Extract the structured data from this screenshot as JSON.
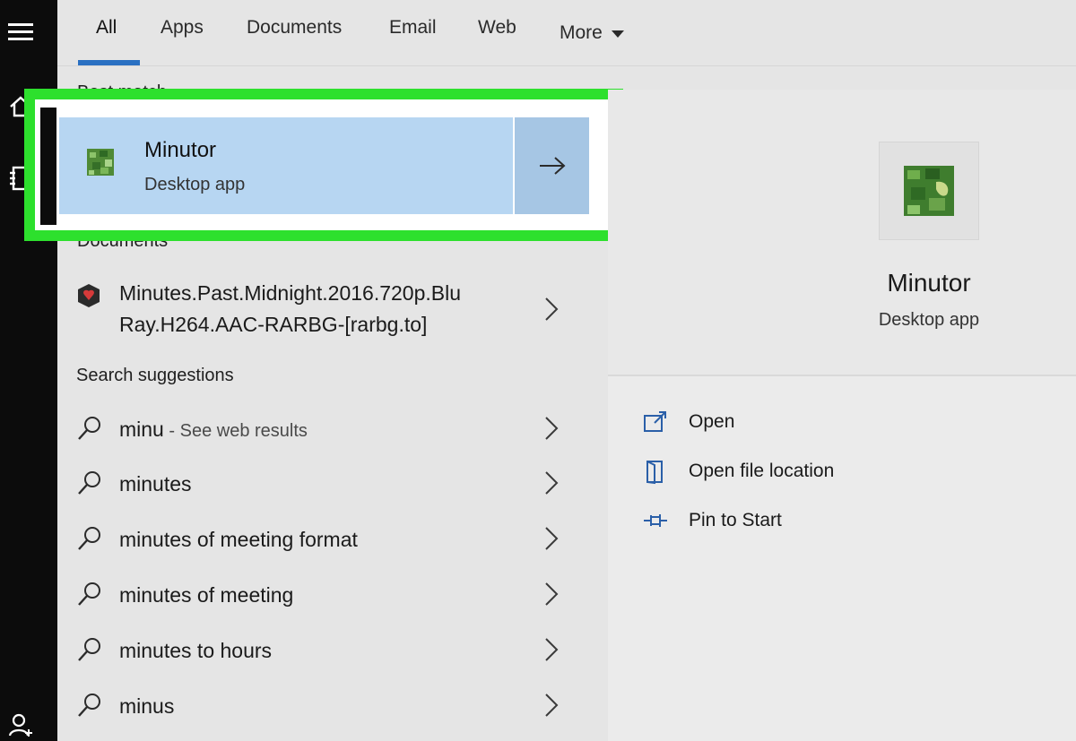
{
  "tabs": [
    {
      "label": "All"
    },
    {
      "label": "Apps"
    },
    {
      "label": "Documents"
    },
    {
      "label": "Email"
    },
    {
      "label": "Web"
    },
    {
      "label": "More"
    }
  ],
  "best_match": {
    "heading": "Best match",
    "title": "Minutor",
    "subtitle": "Desktop app"
  },
  "documents": {
    "heading": "Documents",
    "item": {
      "line1": "Minutes.Past.Midnight.2016.720p.Blu",
      "line2": "Ray.H264.AAC-RARBG-[rarbg.to]"
    }
  },
  "suggestions": {
    "heading": "Search suggestions",
    "items": [
      {
        "text": "minu",
        "hint": " - See web results"
      },
      {
        "text": "minutes"
      },
      {
        "text": "minutes of meeting format"
      },
      {
        "text": "minutes of meeting"
      },
      {
        "text": "minutes to hours"
      },
      {
        "text": "minus"
      }
    ]
  },
  "preview": {
    "title": "Minutor",
    "subtitle": "Desktop app",
    "actions": [
      {
        "label": "Open",
        "icon": "open-icon"
      },
      {
        "label": "Open file location",
        "icon": "folder-icon"
      },
      {
        "label": "Pin to Start",
        "icon": "pin-icon"
      }
    ]
  },
  "colors": {
    "highlight": "#2de02d",
    "selection": "#b7d6f2",
    "accent": "#2a70c2"
  }
}
